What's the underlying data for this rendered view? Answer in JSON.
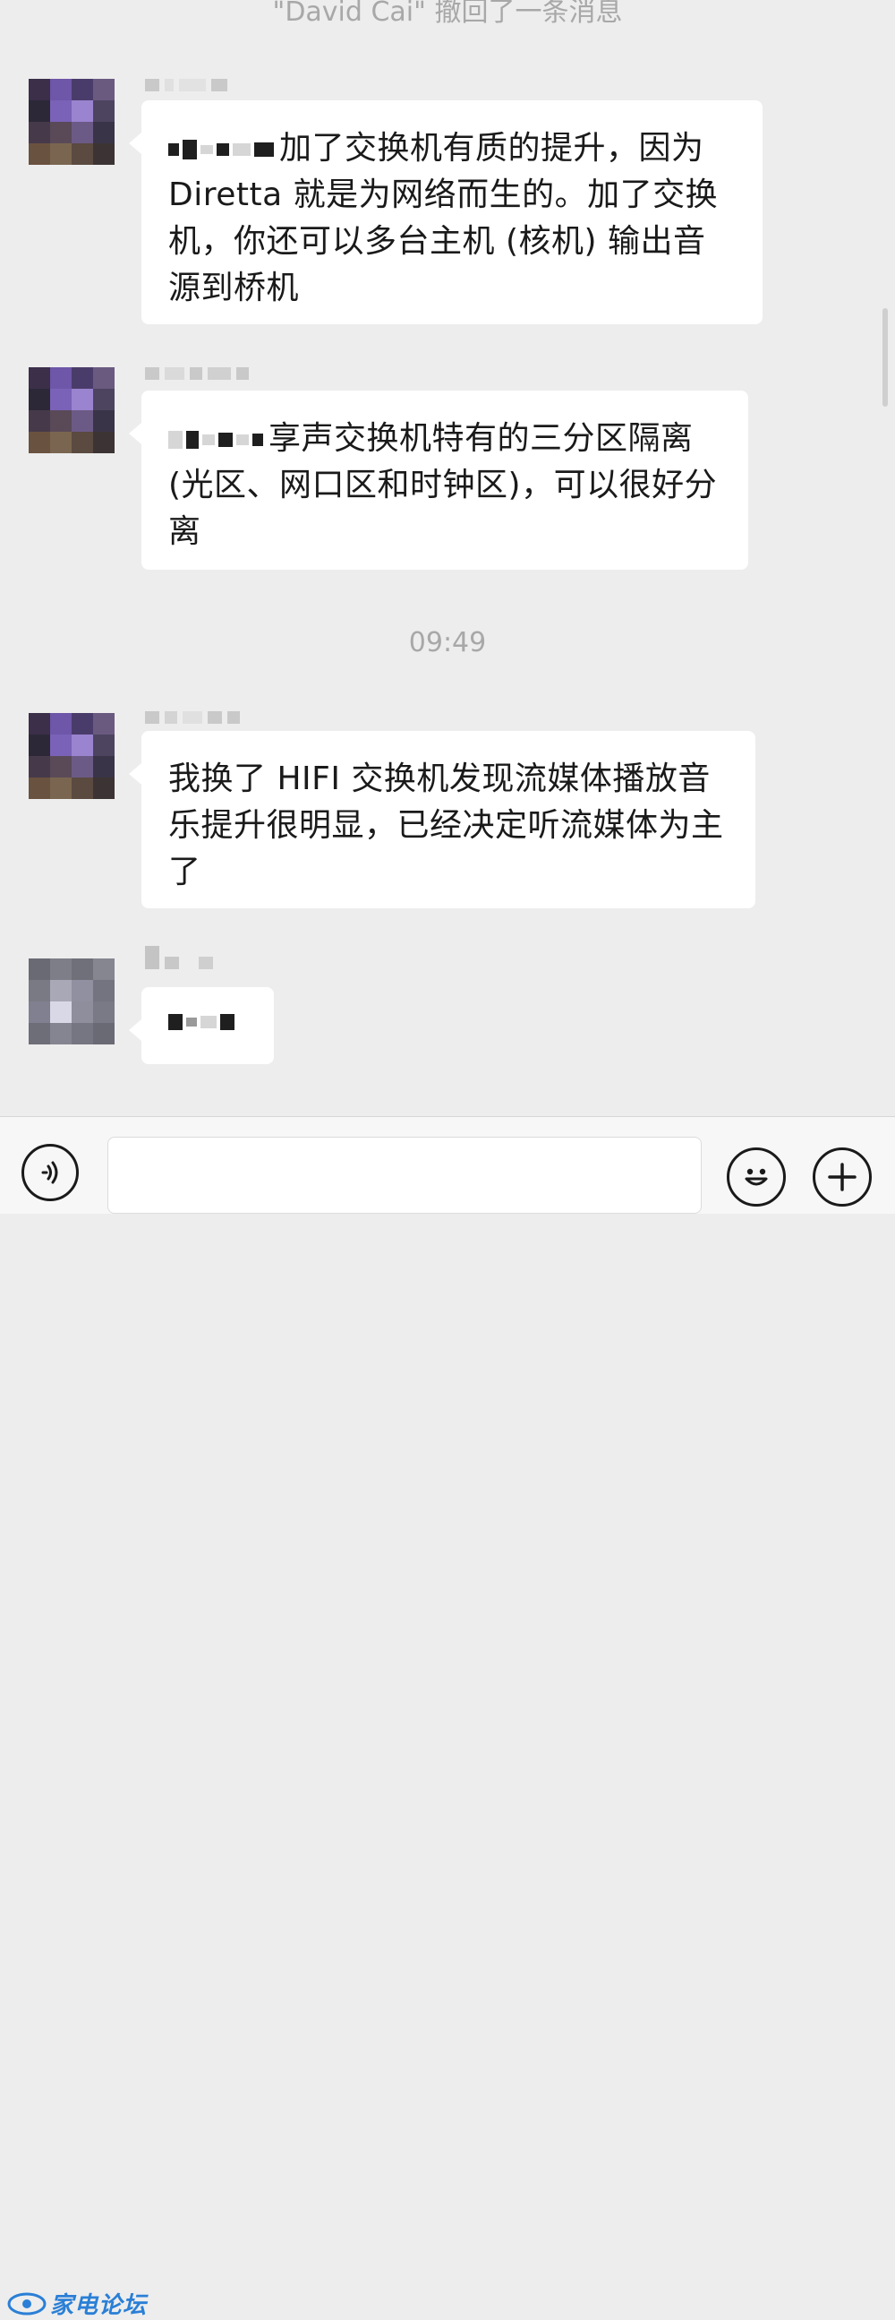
{
  "notice": {
    "text": "\"David Cai\" 撤回了一条消息"
  },
  "messages": [
    {
      "id": 1,
      "text": "加了交换机有质的提升，因为 Diretta 就是为网络而生的。加了交换机，你还可以多台主机 (核机) 输出音源到桥机"
    },
    {
      "id": 2,
      "text": "享声交换机特有的三分区隔离 (光区、网口区和时钟区)，可以很好分离"
    },
    {
      "id": 3,
      "text": "我换了 HIFI 交换机发现流媒体播放音乐提升很明显，已经决定听流媒体为主了"
    },
    {
      "id": 4,
      "text": ""
    }
  ],
  "timestamp": "09:49",
  "input_bar": {
    "placeholder": "",
    "voice_icon": "voice-icon",
    "emoji_icon": "smiley-icon",
    "plus_icon": "plus-icon"
  },
  "watermark": {
    "brand": "家电论坛"
  },
  "colors": {
    "background": "#ededed",
    "bubble": "#ffffff",
    "meta_text": "#a8a8a8",
    "watermark": "#2a7fd6"
  }
}
